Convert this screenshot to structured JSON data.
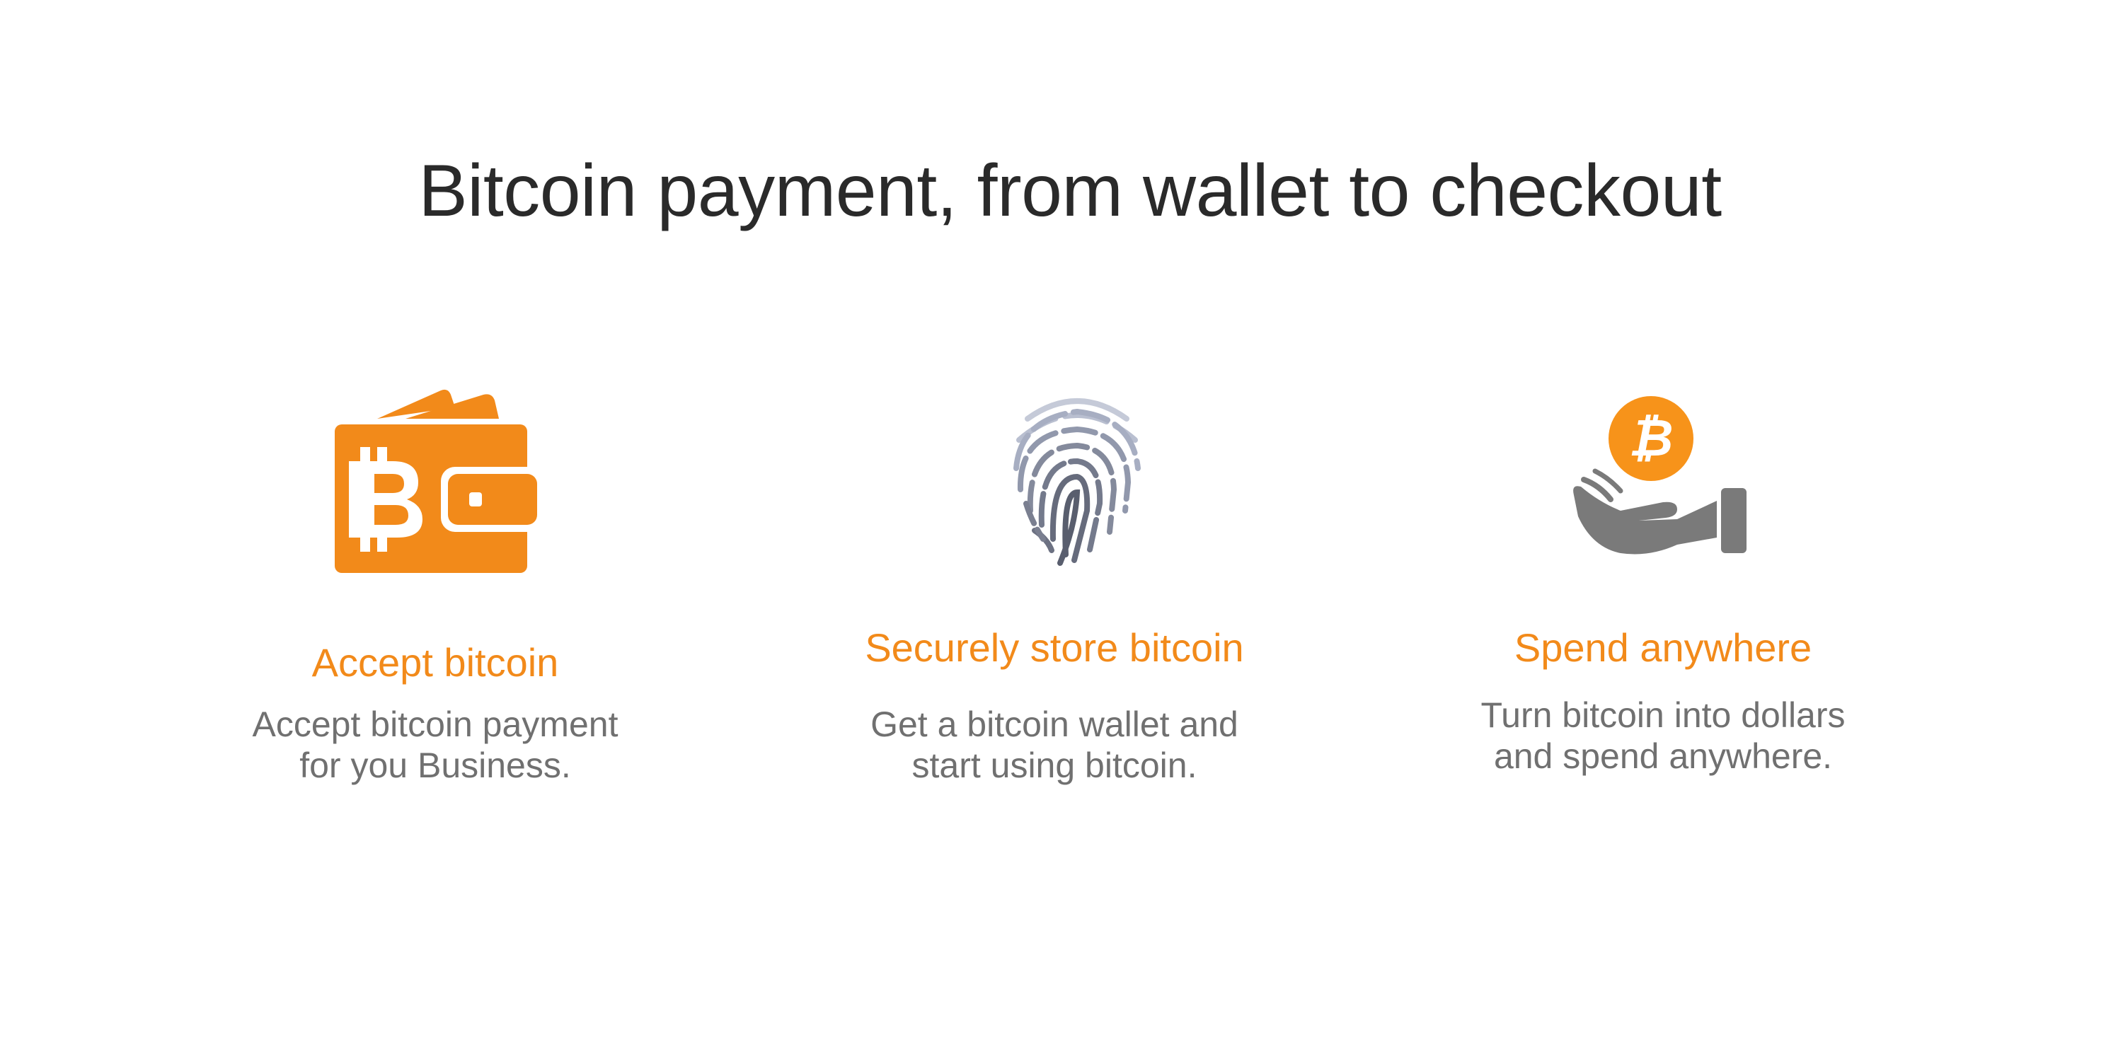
{
  "page": {
    "title": "Bitcoin payment, from wallet to checkout"
  },
  "features": [
    {
      "icon": "bitcoin-wallet-icon",
      "heading": "Accept bitcoin",
      "description_lines": [
        "Accept bitcoin payment",
        "for you Business."
      ]
    },
    {
      "icon": "fingerprint-icon",
      "heading": "Securely store bitcoin",
      "description_lines": [
        "Get a bitcoin wallet and",
        "start using bitcoin."
      ]
    },
    {
      "icon": "hand-bitcoin-icon",
      "heading": "Spend anywhere",
      "description_lines": [
        "Turn bitcoin into dollars",
        "and spend anywhere."
      ]
    }
  ],
  "colors": {
    "accent": "#f28a1a",
    "title": "#2a2a2a",
    "body_text": "#707070",
    "icon_gray": "#7a7a7a"
  }
}
